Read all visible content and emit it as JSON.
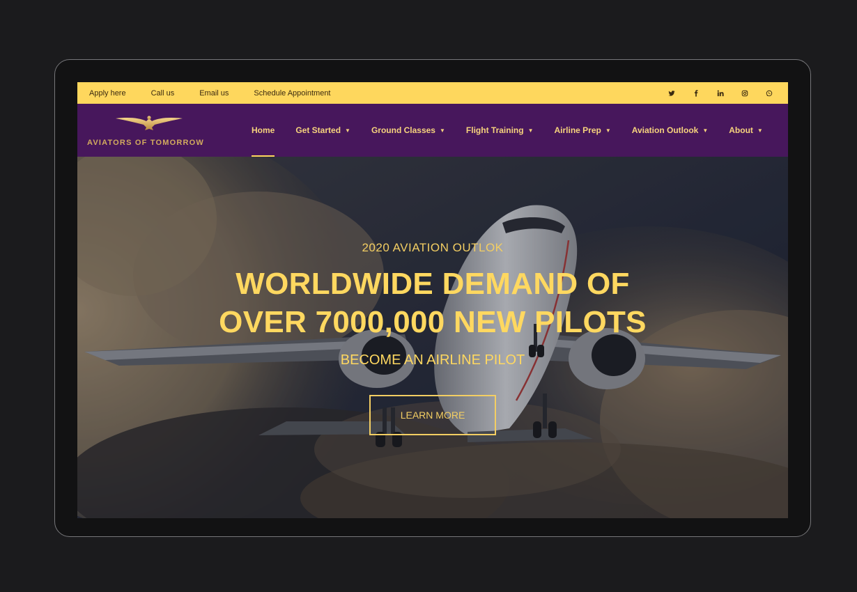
{
  "topbar": {
    "links": [
      "Apply here",
      "Call us",
      "Email us",
      "Schedule Appointment"
    ],
    "social_icons": [
      "twitter-icon",
      "facebook-icon",
      "linkedin-icon",
      "instagram-icon",
      "whatsapp-icon"
    ]
  },
  "brand": {
    "name": "AVIATORS OF TOMORROW",
    "logo_icon": "eagle-wings-icon"
  },
  "nav": {
    "items": [
      {
        "label": "Home",
        "active": true,
        "dropdown": false
      },
      {
        "label": "Get Started",
        "dropdown": true
      },
      {
        "label": "Ground Classes",
        "dropdown": true
      },
      {
        "label": "Flight Training",
        "dropdown": true
      },
      {
        "label": "Airline Prep",
        "dropdown": true
      },
      {
        "label": "Aviation Outlook",
        "dropdown": true
      },
      {
        "label": "About",
        "dropdown": true
      }
    ]
  },
  "hero": {
    "kicker": "2020 AVIATION OUTLOK",
    "headline_line1": "WORLDWIDE DEMAND OF",
    "headline_line2": "OVER 7000,000 NEW PILOTS",
    "subhead": "BECOME AN AIRLINE PILOT",
    "cta_label": "LEARN MORE"
  },
  "colors": {
    "accent_yellow": "#fed75d",
    "nav_purple": "#47175c",
    "frame_bg": "#1b1b1d"
  }
}
